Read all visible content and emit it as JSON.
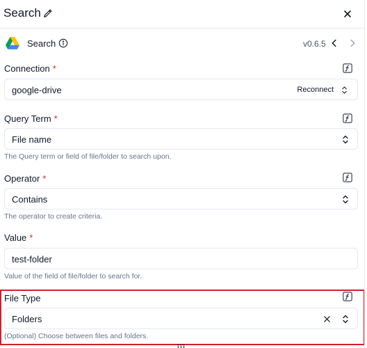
{
  "header": {
    "title": "Search"
  },
  "piece": {
    "name": "Search",
    "version": "v0.6.5"
  },
  "fields": {
    "connection": {
      "label": "Connection",
      "required": "*",
      "value": "google-drive",
      "action": "Reconnect"
    },
    "query_term": {
      "label": "Query Term",
      "required": "*",
      "value": "File name",
      "hint": "The Query term or field of file/folder to search upon."
    },
    "operator": {
      "label": "Operator",
      "required": "*",
      "value": "Contains",
      "hint": "The operator to create criteria."
    },
    "value": {
      "label": "Value",
      "required": "*",
      "value": "test-folder",
      "hint": "Value of the field of file/folder to search for."
    },
    "file_type": {
      "label": "File Type",
      "value": "Folders",
      "hint": "(Optional) Choose between files and folders."
    }
  },
  "colors": {
    "required": "#dc2626",
    "highlight": "#d0202a",
    "hint": "#64748b"
  }
}
